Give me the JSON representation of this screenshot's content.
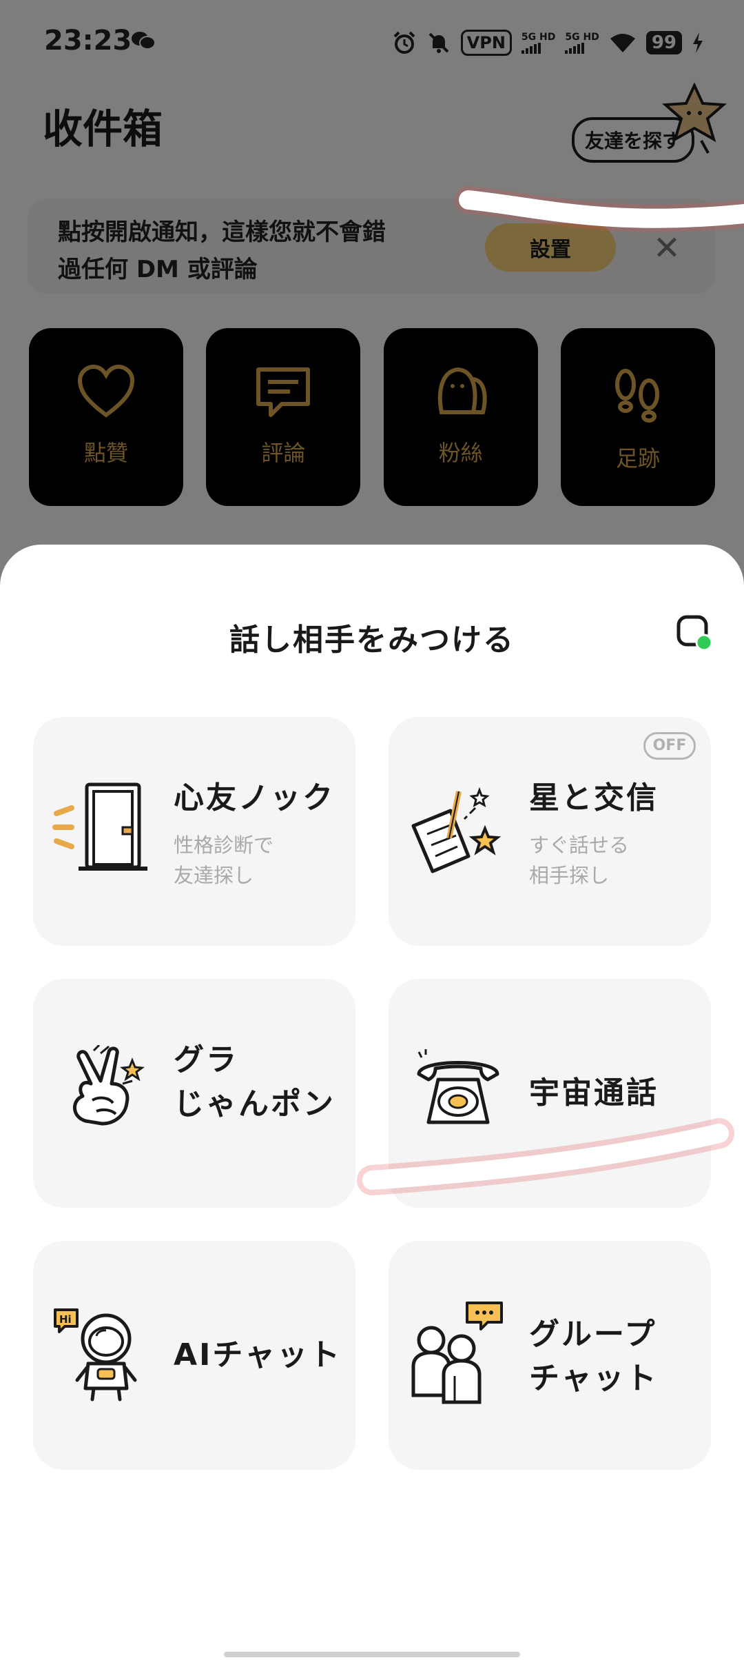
{
  "status_bar": {
    "time": "23:23",
    "vpn": "VPN",
    "sim1_label": "5G HD",
    "sim2_label": "5G HD",
    "battery": "99",
    "icons": [
      "wechat-icon",
      "alarm-icon",
      "mute-icon",
      "signal-icon",
      "wifi-icon",
      "charging-icon"
    ]
  },
  "inbox": {
    "title": "收件箱",
    "find_friend_button": "友達を探す",
    "notice": {
      "text": "點按開啟通知，這樣您就不會錯\n過任何 DM 或評論",
      "button": "設置",
      "close": "✕"
    },
    "categories": [
      {
        "label": "點贊",
        "icon": "heart-icon"
      },
      {
        "label": "評論",
        "icon": "comment-icon"
      },
      {
        "label": "粉絲",
        "icon": "fans-icon"
      },
      {
        "label": "足跡",
        "icon": "footprints-icon"
      }
    ]
  },
  "sheet": {
    "title": "話し相手をみつける",
    "cards": [
      {
        "title": "心友ノック",
        "subtitle": "性格診断で\n友達探し",
        "icon": "door-icon"
      },
      {
        "title": "星と交信",
        "subtitle": "すぐ話せる\n相手探し",
        "badge": "OFF",
        "icon": "star-letter-icon"
      },
      {
        "title": "グラ\nじゃんポン",
        "icon": "peace-hand-icon"
      },
      {
        "title": "宇宙通話",
        "icon": "telephone-icon"
      },
      {
        "title": "AIチャット",
        "icon": "astronaut-icon",
        "icon_text": "Hi"
      },
      {
        "title": "グループ\nチャット",
        "icon": "group-chat-icon"
      }
    ]
  },
  "colors": {
    "accent_gold": "#d8a84c",
    "button_yellow": "#f6d27a",
    "online_green": "#2ecc55",
    "scribble_red": "#e05050"
  }
}
